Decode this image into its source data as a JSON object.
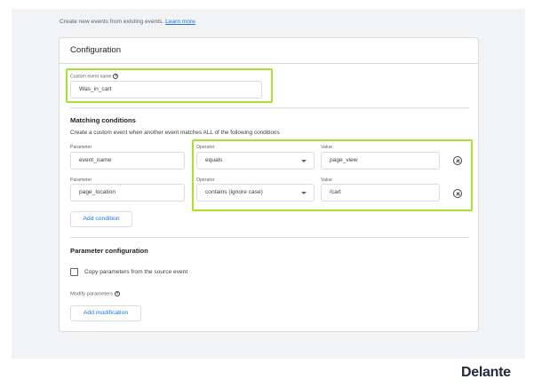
{
  "intro": {
    "text": "Create new events from existing events.",
    "link": "Learn more"
  },
  "configuration": {
    "title": "Configuration",
    "custom_event_label": "Custom event name",
    "custom_event_value": "Was_in_cart"
  },
  "matching": {
    "title": "Matching conditions",
    "description": "Create a custom event when another event matches ALL of the following conditions",
    "rows": [
      {
        "parameter_label": "Parameter",
        "parameter": "event_name",
        "operator_label": "Operator",
        "operator": "equals",
        "value_label": "Value",
        "value": "page_view"
      },
      {
        "parameter_label": "Parameter",
        "parameter": "page_location",
        "operator_label": "Operator",
        "operator": "contains (ignore case)",
        "value_label": "Value",
        "value": "/cart"
      }
    ],
    "add_condition": "Add condition"
  },
  "parameter_config": {
    "title": "Parameter configuration",
    "copy_label": "Copy parameters from the source event",
    "copy_checked": false,
    "modify_label": "Modify parameters",
    "add_modification": "Add modification"
  },
  "highlight_color": "#a6e22e",
  "brand": "Delante"
}
